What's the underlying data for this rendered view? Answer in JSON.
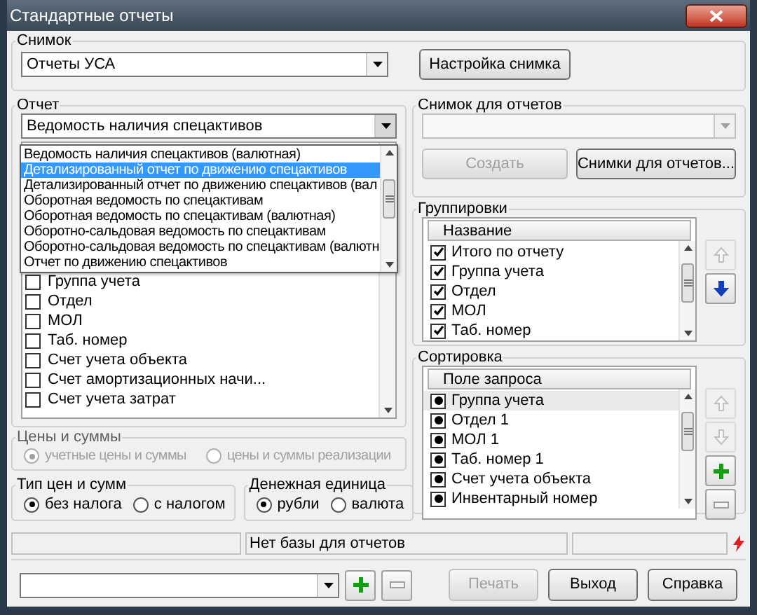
{
  "window": {
    "title": "Стандартные отчеты"
  },
  "snapshot": {
    "label": "Снимок",
    "value": "Отчеты УСА",
    "button": "Настройка снимка"
  },
  "report": {
    "label": "Отчет",
    "value": "Ведомость наличия спецактивов",
    "expanded": true,
    "options": [
      {
        "text": "Ведомость наличия спецактивов (валютная)",
        "selected": false
      },
      {
        "text": "Детализированный отчет по движению спецактивов",
        "selected": true
      },
      {
        "text": "Детализированный отчет по движению спецактивов (вал",
        "selected": false
      },
      {
        "text": "Оборотная ведомость по спецактивам",
        "selected": false
      },
      {
        "text": "Оборотная ведомость по спецактивам (валютная)",
        "selected": false
      },
      {
        "text": "Оборотно-сальдовая ведомость по спецактивам",
        "selected": false
      },
      {
        "text": "Оборотно-сальдовая ведомость по спецактивам (валютн",
        "selected": false
      },
      {
        "text": "Отчет по движению спецактивов",
        "selected": false
      }
    ],
    "fields": [
      {
        "text": "Группа учета",
        "checked": false
      },
      {
        "text": "Отдел",
        "checked": false
      },
      {
        "text": "МОЛ",
        "checked": false
      },
      {
        "text": "Таб. номер",
        "checked": false
      },
      {
        "text": "Счет учета объекта",
        "checked": false
      },
      {
        "text": "Счет амортизационных начи...",
        "checked": false
      },
      {
        "text": "Счет учета затрат",
        "checked": false
      }
    ]
  },
  "prices": {
    "label": "Цены и суммы",
    "disabled": true,
    "options": [
      {
        "text": "учетные цены и суммы",
        "selected": true
      },
      {
        "text": "цены и суммы реализации",
        "selected": false
      }
    ]
  },
  "price_type": {
    "label": "Тип цен и сумм",
    "disabled": false,
    "options": [
      {
        "text": "без налога",
        "selected": true
      },
      {
        "text": "с налогом",
        "selected": false
      }
    ]
  },
  "currency": {
    "label": "Денежная единица",
    "disabled": false,
    "options": [
      {
        "text": "рубли",
        "selected": true
      },
      {
        "text": "валюта",
        "selected": false
      }
    ]
  },
  "report_snapshot": {
    "label": "Снимок для отчетов",
    "disabled": true,
    "buttons": [
      {
        "text": "Создать",
        "disabled": true
      },
      {
        "text": "Снимки для отчетов...",
        "disabled": false
      }
    ]
  },
  "groupings": {
    "label": "Группировки",
    "column": "Название",
    "items": [
      {
        "text": "Итого по отчету",
        "checked": true,
        "selected": false
      },
      {
        "text": "Группа учета",
        "checked": true,
        "selected": false
      },
      {
        "text": "Отдел",
        "checked": true,
        "selected": false
      },
      {
        "text": "МОЛ",
        "checked": true,
        "selected": false
      },
      {
        "text": "Таб. номер",
        "checked": true,
        "selected": false
      }
    ],
    "tools": [
      {
        "kind": "up",
        "disabled": true
      },
      {
        "kind": "down",
        "disabled": false
      }
    ]
  },
  "sorting": {
    "label": "Сортировка",
    "column": "Поле запроса",
    "items": [
      {
        "text": "Группа учета",
        "checked": true,
        "selected": true
      },
      {
        "text": "Отдел 1",
        "checked": true,
        "selected": false
      },
      {
        "text": "МОЛ 1",
        "checked": true,
        "selected": false
      },
      {
        "text": "Таб. номер 1",
        "checked": true,
        "selected": false
      },
      {
        "text": "Счет учета объекта",
        "checked": true,
        "selected": false
      },
      {
        "text": "Инвентарный номер",
        "checked": true,
        "selected": false
      }
    ],
    "tools": [
      {
        "kind": "up",
        "disabled": true
      },
      {
        "kind": "down",
        "disabled": true
      },
      {
        "kind": "add",
        "disabled": false
      },
      {
        "kind": "remove",
        "disabled": false
      }
    ]
  },
  "status_bar": {
    "message": "Нет базы для отчетов"
  },
  "footer": {
    "tools": [
      {
        "kind": "add",
        "disabled": false
      },
      {
        "kind": "remove",
        "disabled": false
      }
    ],
    "buttons": [
      {
        "text": "Печать",
        "disabled": true
      },
      {
        "text": "Выход",
        "disabled": false
      },
      {
        "text": "Справка",
        "disabled": false
      }
    ]
  }
}
